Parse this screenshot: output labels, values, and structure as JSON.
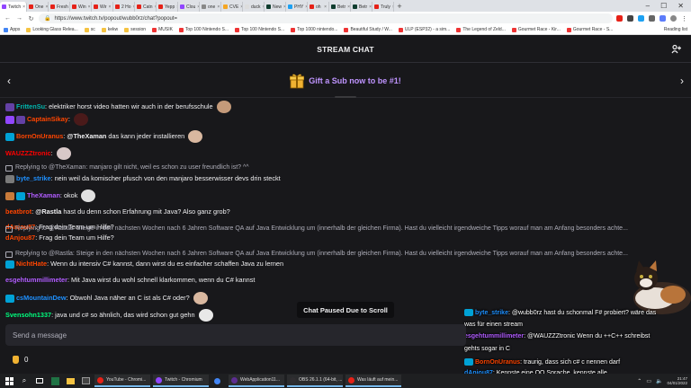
{
  "browser": {
    "tabs": [
      {
        "label": "Twitch",
        "color": "#9146ff",
        "active": true
      },
      {
        "label": "One",
        "color": "#e62117"
      },
      {
        "label": "Fresh",
        "color": "#e62117"
      },
      {
        "label": "Win",
        "color": "#e62117"
      },
      {
        "label": "Wir",
        "color": "#e62117"
      },
      {
        "label": "2 Ho",
        "color": "#e62117"
      },
      {
        "label": "Catn",
        "color": "#e62117"
      },
      {
        "label": "Yepp",
        "color": "#e62117"
      },
      {
        "label": "Clou",
        "color": "#9146ff"
      },
      {
        "label": "one",
        "color": "#888888"
      },
      {
        "label": "CVE",
        "color": "#f5a623"
      },
      {
        "label": "duck",
        "color": "#dddddd"
      },
      {
        "label": "New",
        "color": "#0f3d2e"
      },
      {
        "label": "PHY",
        "color": "#1da1f2"
      },
      {
        "label": "oh",
        "color": "#e62117"
      },
      {
        "label": "Betr",
        "color": "#0f3d2e"
      },
      {
        "label": "Betr",
        "color": "#0f3d2e"
      },
      {
        "label": "Truly",
        "color": "#e62117"
      }
    ],
    "new_tab": "+",
    "window_controls": [
      "–",
      "☐",
      "✕"
    ],
    "url": "https://www.twitch.tv/popout/wubb0rz/chat?popout=",
    "bookmarks": [
      "Apps",
      "Looking Glass Relea...",
      "sc",
      "kekw",
      "session",
      "MUSIK",
      "Top 100 Nintendo S...",
      "Top 100 Nintendo S...",
      "Top 1000 nintendo...",
      "Beautiful Study / W...",
      "ULP (ESP32) - a sim...",
      "The Legend of Zeld...",
      "Gourmet Race - Kir...",
      "Gourmet Race - S..."
    ],
    "reading_list": "Reading list"
  },
  "chat": {
    "header_title": "STREAM CHAT",
    "gift_text": "Gift a Sub now to be #1!",
    "paused_label": "Chat Paused Due to Scroll",
    "input_placeholder": "Send a message",
    "points_value": "0",
    "messages": [
      {
        "type": "msg",
        "user": "FrittenSu",
        "user_color": "#00b5ad",
        "text": ": elektriker horst video hatten wir auch in der berufsschule",
        "emote": "#c49a7a",
        "badges": [
          "#6441a5"
        ]
      },
      {
        "type": "msg",
        "user": "CaptainSikay",
        "user_color": "#ff4500",
        "text": ":",
        "emote": "#4a1a1a",
        "badges": [
          "#9146ff",
          "#6441a5"
        ]
      },
      {
        "type": "msg",
        "user": "BornOnUranus",
        "user_color": "#ff4500",
        "text": ": ",
        "mention": "@TheXaman",
        "rest": " das kann jeder installieren",
        "emote": "#d9b8a0",
        "badges": [
          "#00a2d6"
        ]
      },
      {
        "type": "msg",
        "user": "WAUZZZtronic",
        "user_color": "#ff0000",
        "text": ":",
        "emote": "#d8c8c8",
        "badges": []
      },
      {
        "type": "reply",
        "text": "Replying to @TheXaman: manjaro gilt nicht, weil es schon zu user freundlich ist? ^^"
      },
      {
        "type": "msg",
        "user": "byte_strike",
        "user_color": "#1e90ff",
        "text": ": nein weil da komischer pfusch von den manjaro besserwisser devs drin steckt",
        "badges": [
          "#7a7a7a"
        ]
      },
      {
        "type": "msg",
        "user": "TheXaman",
        "user_color": "#b15cff",
        "text": ": okok",
        "emote": "#e0e0e0",
        "badges": [
          "#c87a3a",
          "#00a2d6"
        ]
      },
      {
        "type": "msg",
        "user": "beatbrot",
        "user_color": "#ff4500",
        "text": ": ",
        "mention": "@Rastla",
        "rest": " hast du denn schon Erfahrung mit Java? Also ganz grob?",
        "badges": []
      },
      {
        "type": "msg",
        "user": "dAnjou87",
        "user_color": "#ff4500",
        "text": ": Frag dein Team um Hilfe?",
        "badges": []
      },
      {
        "type": "reply",
        "text": "Replying to @Rastla: Steige in den nächsten Wochen nach 6 Jahren Software QA auf Java Entwicklung um (innerhalb der gleichen Firma). Hast du vielleicht irgendweiche Tipps worauf man am Anfang besonders achte..."
      },
      {
        "type": "msg",
        "user": "dAnjou87",
        "user_color": "#ff4500",
        "text": ": Frag dein Team um Hilfe?",
        "badges": []
      },
      {
        "type": "reply",
        "text": "Replying to @Rastla: Steige in den nächsten Wochen nach 6 Jahren Software QA auf Java Entwicklung um (innerhalb der gleichen Firma). Hast du vielleicht irgendweiche Tipps worauf man am Anfang besonders achte..."
      },
      {
        "type": "msg",
        "user": "NichtHate",
        "user_color": "#ff4500",
        "text": ": Wenn du intensiv C# kannst, dann wirst du es einfacher schaffen Java zu lernen",
        "badges": [
          "#00a2d6"
        ]
      },
      {
        "type": "msg",
        "user": "esgehtummillimeter",
        "user_color": "#b15cff",
        "text": ": Mit Java wirst du wohl schnell klarkommen, wenn du C# kannst",
        "badges": []
      },
      {
        "type": "msg",
        "user": "csMountainDew",
        "user_color": "#1e90ff",
        "text": ": Obwohl Java näher an C ist als C# oder?",
        "emote": "#d9b8a0",
        "badges": [
          "#00a2d6"
        ]
      },
      {
        "type": "msg",
        "user": "Svensohn1337",
        "user_color": "#00ff7f",
        "text": ": java und c# so ähnlich, das wird schon gut gehn",
        "emote": "#e8e8e8",
        "badges": []
      }
    ]
  },
  "overlay_chat": [
    {
      "user": "byte_strike",
      "user_color": "#1e90ff",
      "text": ": @wubb0rz hast du schonmal F# probiert? wäre das",
      "badge": "#00a2d6"
    },
    {
      "user": "",
      "user_color": "#ffffff",
      "text": "was für einen stream",
      "badge": ""
    },
    {
      "user": "esgehtummillimeter",
      "user_color": "#b15cff",
      "text": ": @WAUZZZtronic Wenn du ++C++ schreibst",
      "badge": ""
    },
    {
      "user": "",
      "user_color": "#ffffff",
      "text": "gehts sogar in C",
      "badge": ""
    },
    {
      "user": "BornOnUranus",
      "user_color": "#ff4500",
      "text": ": traurig, dass sich c# c nennen darf",
      "badge": "#00a2d6"
    },
    {
      "user": "dAnjou87",
      "user_color": "#1e90ff",
      "text": ": Kennste eine OO Sprache, kennste alle",
      "badge": ""
    }
  ],
  "taskbar": {
    "apps": [
      {
        "label": "YouTube - Chromi...",
        "color": "#e62117"
      },
      {
        "label": "Twitch - Chromium",
        "color": "#9146ff"
      },
      {
        "label": "",
        "color": "#4285f4"
      },
      {
        "label": "WebApplication11...",
        "color": "#5c2d91"
      },
      {
        "label": "OBS 26.1.1 (64-bit, ...",
        "color": "#302e31"
      },
      {
        "label": "Was läuft auf mein...",
        "color": "#e62117"
      }
    ],
    "time": "21:47",
    "date": "04/01/2022"
  }
}
